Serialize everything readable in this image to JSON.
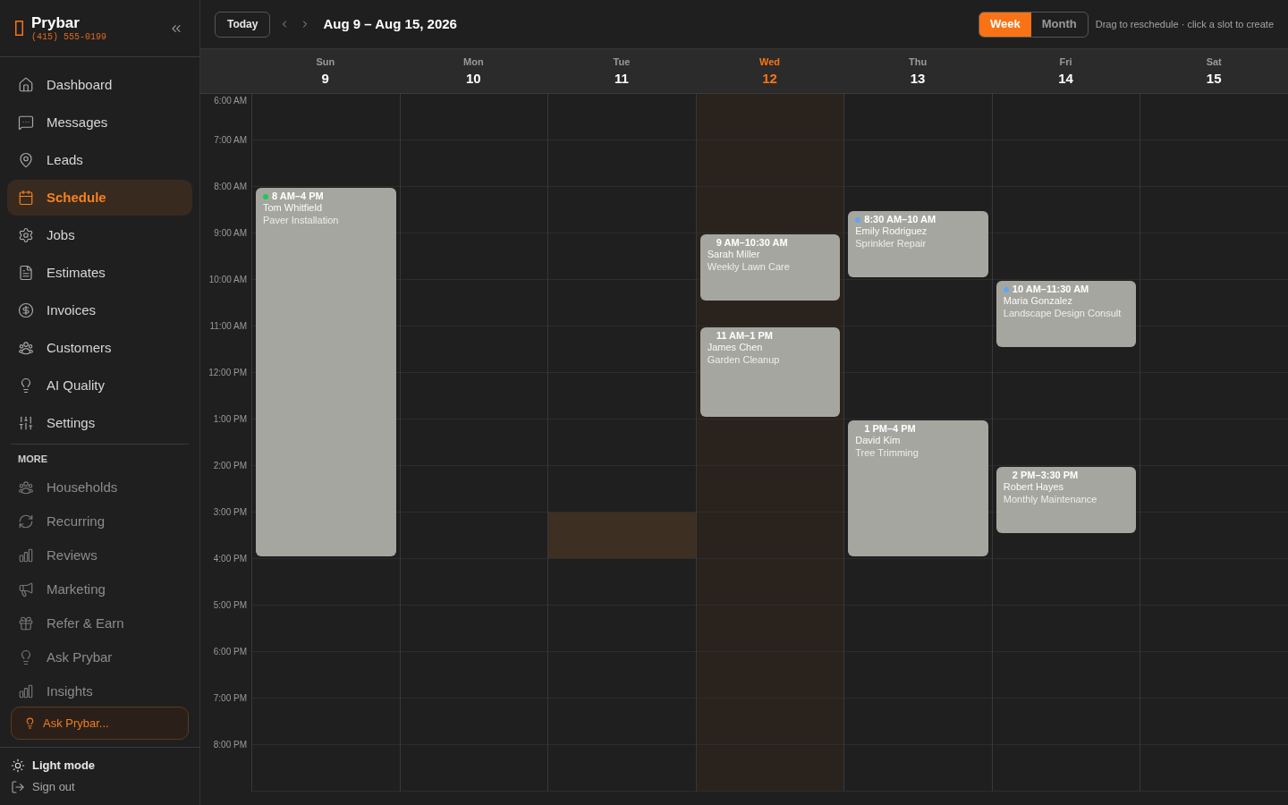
{
  "sidebar": {
    "brand": {
      "name": "Prybar",
      "phone": "(415) 555-0199"
    },
    "nav_items": [
      {
        "label": "Dashboard",
        "selected": false
      },
      {
        "label": "Messages",
        "selected": false
      },
      {
        "label": "Leads",
        "selected": false
      },
      {
        "label": "Schedule",
        "selected": true
      },
      {
        "label": "Jobs",
        "selected": false
      },
      {
        "label": "Estimates",
        "selected": false
      },
      {
        "label": "Invoices",
        "selected": false
      },
      {
        "label": "Customers",
        "selected": false
      },
      {
        "label": "AI Quality",
        "selected": false
      },
      {
        "label": "Settings",
        "selected": false
      }
    ],
    "more_heading": "MORE",
    "more_items": [
      {
        "label": "Households"
      },
      {
        "label": "Recurring"
      },
      {
        "label": "Reviews"
      },
      {
        "label": "Marketing"
      },
      {
        "label": "Refer & Earn"
      },
      {
        "label": "Ask Prybar"
      },
      {
        "label": "Insights"
      }
    ],
    "ask_button": {
      "label": "Ask Prybar..."
    },
    "footer": [
      {
        "label": "Light mode"
      },
      {
        "label": "Sign out"
      }
    ]
  },
  "toolbar": {
    "today_button": "Today",
    "date_range": "Aug 9 – Aug 15, 2026",
    "views": [
      {
        "label": "Week",
        "selected": true
      },
      {
        "label": "Month",
        "selected": false
      }
    ],
    "hint": "Drag to reschedule · click a slot to create"
  },
  "calendar": {
    "hours": [
      {
        "label": "6:00 AM"
      },
      {
        "label": "7:00 AM"
      },
      {
        "label": "8:00 AM"
      },
      {
        "label": "9:00 AM"
      },
      {
        "label": "10:00 AM"
      },
      {
        "label": "11:00 AM"
      },
      {
        "label": "12:00 PM"
      },
      {
        "label": "1:00 PM"
      },
      {
        "label": "2:00 PM"
      },
      {
        "label": "3:00 PM"
      },
      {
        "label": "4:00 PM"
      },
      {
        "label": "5:00 PM"
      },
      {
        "label": "6:00 PM"
      },
      {
        "label": "7:00 PM"
      },
      {
        "label": "8:00 PM"
      }
    ],
    "days": [
      {
        "name": "Sun",
        "date": "9",
        "today": false,
        "slots": [
          {
            "highlighted": false
          },
          {
            "highlighted": false
          },
          {
            "highlighted": false
          },
          {
            "highlighted": false
          },
          {
            "highlighted": false
          },
          {
            "highlighted": false
          },
          {
            "highlighted": false
          },
          {
            "highlighted": false
          },
          {
            "highlighted": false
          },
          {
            "highlighted": false
          },
          {
            "highlighted": false
          },
          {
            "highlighted": false
          },
          {
            "highlighted": false
          },
          {
            "highlighted": false
          },
          {
            "highlighted": false
          }
        ],
        "events": [
          {
            "time": "8 AM–4 PM",
            "customer": "Tom Whitfield",
            "service": "Paver Installation",
            "color": "#22c55e"
          }
        ]
      },
      {
        "name": "Mon",
        "date": "10",
        "today": false,
        "slots": [
          {
            "highlighted": false
          },
          {
            "highlighted": false
          },
          {
            "highlighted": false
          },
          {
            "highlighted": false
          },
          {
            "highlighted": false
          },
          {
            "highlighted": false
          },
          {
            "highlighted": false
          },
          {
            "highlighted": false
          },
          {
            "highlighted": false
          },
          {
            "highlighted": false
          },
          {
            "highlighted": false
          },
          {
            "highlighted": false
          },
          {
            "highlighted": false
          },
          {
            "highlighted": false
          },
          {
            "highlighted": false
          }
        ]
      },
      {
        "name": "Tue",
        "date": "11",
        "today": false,
        "slots": [
          {
            "highlighted": false
          },
          {
            "highlighted": false
          },
          {
            "highlighted": false
          },
          {
            "highlighted": false
          },
          {
            "highlighted": false
          },
          {
            "highlighted": false
          },
          {
            "highlighted": false
          },
          {
            "highlighted": false
          },
          {
            "highlighted": false
          },
          {
            "highlighted": true
          },
          {
            "highlighted": false
          },
          {
            "highlighted": false
          },
          {
            "highlighted": false
          },
          {
            "highlighted": false
          },
          {
            "highlighted": false
          }
        ]
      },
      {
        "name": "Wed",
        "date": "12",
        "today": true,
        "slots": [
          {
            "highlighted": false
          },
          {
            "highlighted": false
          },
          {
            "highlighted": false
          },
          {
            "highlighted": false
          },
          {
            "highlighted": false
          },
          {
            "highlighted": false
          },
          {
            "highlighted": false
          },
          {
            "highlighted": false
          },
          {
            "highlighted": false
          },
          {
            "highlighted": false
          },
          {
            "highlighted": false
          },
          {
            "highlighted": false
          },
          {
            "highlighted": false
          },
          {
            "highlighted": false
          },
          {
            "highlighted": false
          }
        ],
        "events": [
          {
            "time": "9 AM–10:30 AM",
            "customer": "Sarah Miller",
            "service": "Weekly Lawn Care"
          },
          {
            "time": "11 AM–1 PM",
            "customer": "James Chen",
            "service": "Garden Cleanup"
          }
        ]
      },
      {
        "name": "Thu",
        "date": "13",
        "today": false,
        "slots": [
          {
            "highlighted": false
          },
          {
            "highlighted": false
          },
          {
            "highlighted": false
          },
          {
            "highlighted": false
          },
          {
            "highlighted": false
          },
          {
            "highlighted": false
          },
          {
            "highlighted": false
          },
          {
            "highlighted": false
          },
          {
            "highlighted": false
          },
          {
            "highlighted": false
          },
          {
            "highlighted": false
          },
          {
            "highlighted": false
          },
          {
            "highlighted": false
          },
          {
            "highlighted": false
          },
          {
            "highlighted": false
          }
        ],
        "events": [
          {
            "time": "8:30 AM–10 AM",
            "customer": "Emily Rodriguez",
            "service": "Sprinkler Repair",
            "color": "#60a5fa"
          },
          {
            "time": "1 PM–4 PM",
            "customer": "David Kim",
            "service": "Tree Trimming"
          }
        ]
      },
      {
        "name": "Fri",
        "date": "14",
        "today": false,
        "slots": [
          {
            "highlighted": false
          },
          {
            "highlighted": false
          },
          {
            "highlighted": false
          },
          {
            "highlighted": false
          },
          {
            "highlighted": false
          },
          {
            "highlighted": false
          },
          {
            "highlighted": false
          },
          {
            "highlighted": false
          },
          {
            "highlighted": false
          },
          {
            "highlighted": false
          },
          {
            "highlighted": false
          },
          {
            "highlighted": false
          },
          {
            "highlighted": false
          },
          {
            "highlighted": false
          },
          {
            "highlighted": false
          }
        ],
        "events": [
          {
            "time": "10 AM–11:30 AM",
            "customer": "Maria Gonzalez",
            "service": "Landscape Design Consult",
            "color": "#60a5fa"
          },
          {
            "time": "2 PM–3:30 PM",
            "customer": "Robert Hayes",
            "service": "Monthly Maintenance"
          }
        ]
      },
      {
        "name": "Sat",
        "date": "15",
        "today": false,
        "slots": [
          {
            "highlighted": false
          },
          {
            "highlighted": false
          },
          {
            "highlighted": false
          },
          {
            "highlighted": false
          },
          {
            "highlighted": false
          },
          {
            "highlighted": false
          },
          {
            "highlighted": false
          },
          {
            "highlighted": false
          },
          {
            "highlighted": false
          },
          {
            "highlighted": false
          },
          {
            "highlighted": false
          },
          {
            "highlighted": false
          },
          {
            "highlighted": false
          },
          {
            "highlighted": false
          },
          {
            "highlighted": false
          }
        ]
      }
    ]
  }
}
